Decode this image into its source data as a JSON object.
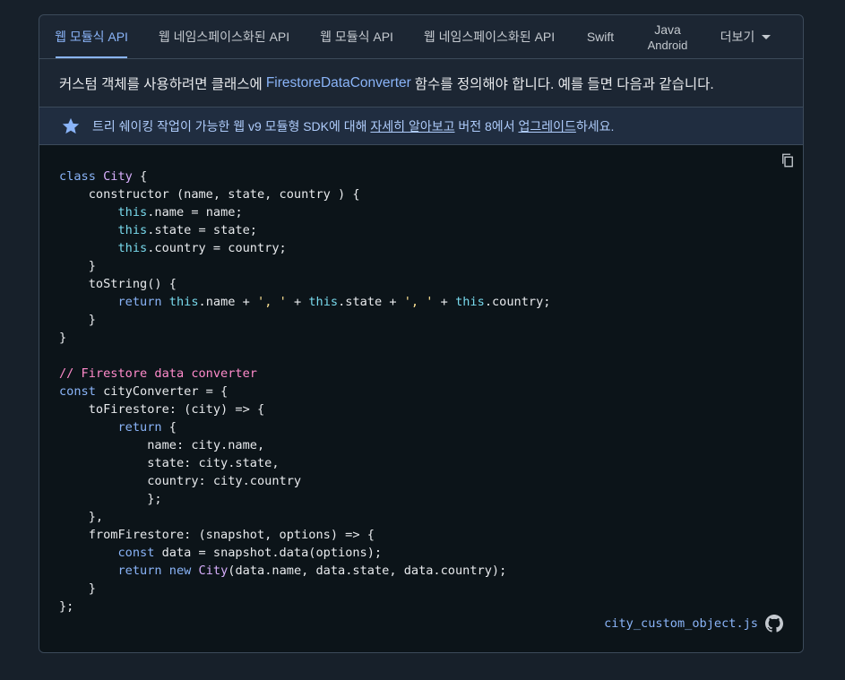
{
  "tabs": [
    {
      "label": "웹 모듈식 API",
      "active": true
    },
    {
      "label": "웹 네임스페이스화된 API"
    },
    {
      "label": "웹 모듈식 API"
    },
    {
      "label": "웹 네임스페이스화된 API"
    },
    {
      "label": "Swift"
    },
    {
      "label": "Java",
      "sub": "Android"
    },
    {
      "label": "더보기"
    }
  ],
  "intro": {
    "before": "커스텀 객체를 사용하려면 클래스에",
    "link": "FirestoreDataConverter",
    "after": "함수를 정의해야 합니다. 예를 들면 다음과 같습니다."
  },
  "notice": {
    "t1": "트리 쉐이킹 작업이 가능한 웹 v9 모듈형 SDK에 대해 ",
    "link1": "자세히 알아보고",
    "t2": " 버전 8에서 ",
    "link2": "업그레이드",
    "t3": "하세요."
  },
  "code": {
    "l01_a": "class ",
    "l01_b": "City",
    "l01_c": " {",
    "l02": "    constructor (name, state, country ) {",
    "l03_a": "        ",
    "l03_b": "this",
    "l03_c": ".name = name;",
    "l04_a": "        ",
    "l04_b": "this",
    "l04_c": ".state = state;",
    "l05_a": "        ",
    "l05_b": "this",
    "l05_c": ".country = country;",
    "l06": "    }",
    "l07": "    toString() {",
    "l08_a": "        ",
    "l08_b": "return",
    "l08_c": " ",
    "l08_d": "this",
    "l08_e": ".name + ",
    "l08_f": "', '",
    "l08_g": " + ",
    "l08_h": "this",
    "l08_i": ".state + ",
    "l08_j": "', '",
    "l08_k": " + ",
    "l08_l": "this",
    "l08_m": ".country;",
    "l09": "    }",
    "l10": "}",
    "l11": "",
    "l12": "// Firestore data converter",
    "l13_a": "const",
    "l13_b": " cityConverter = {",
    "l14": "    toFirestore: (city) => {",
    "l15_a": "        ",
    "l15_b": "return",
    "l15_c": " {",
    "l16": "            name: city.name,",
    "l17": "            state: city.state,",
    "l18": "            country: city.country",
    "l19": "            };",
    "l20": "    },",
    "l21": "    fromFirestore: (snapshot, options) => {",
    "l22_a": "        ",
    "l22_b": "const",
    "l22_c": " data = snapshot.data(options);",
    "l23_a": "        ",
    "l23_b": "return",
    "l23_c": " ",
    "l23_d": "new",
    "l23_e": " ",
    "l23_f": "City",
    "l23_g": "(data.name, data.state, data.country);",
    "l24": "    }",
    "l25": "};"
  },
  "footer": {
    "filename": "city_custom_object.js"
  },
  "icons": {
    "copy": "copy-icon",
    "star": "star-icon",
    "github": "github-icon",
    "caret": "chevron-down-icon"
  },
  "colors": {
    "accent": "#8ab4f8",
    "code_bg": "#0c1419",
    "keyword": "#8ab4f8",
    "class": "#d7aefb",
    "string": "#fde293",
    "comment": "#ff8bcb"
  }
}
